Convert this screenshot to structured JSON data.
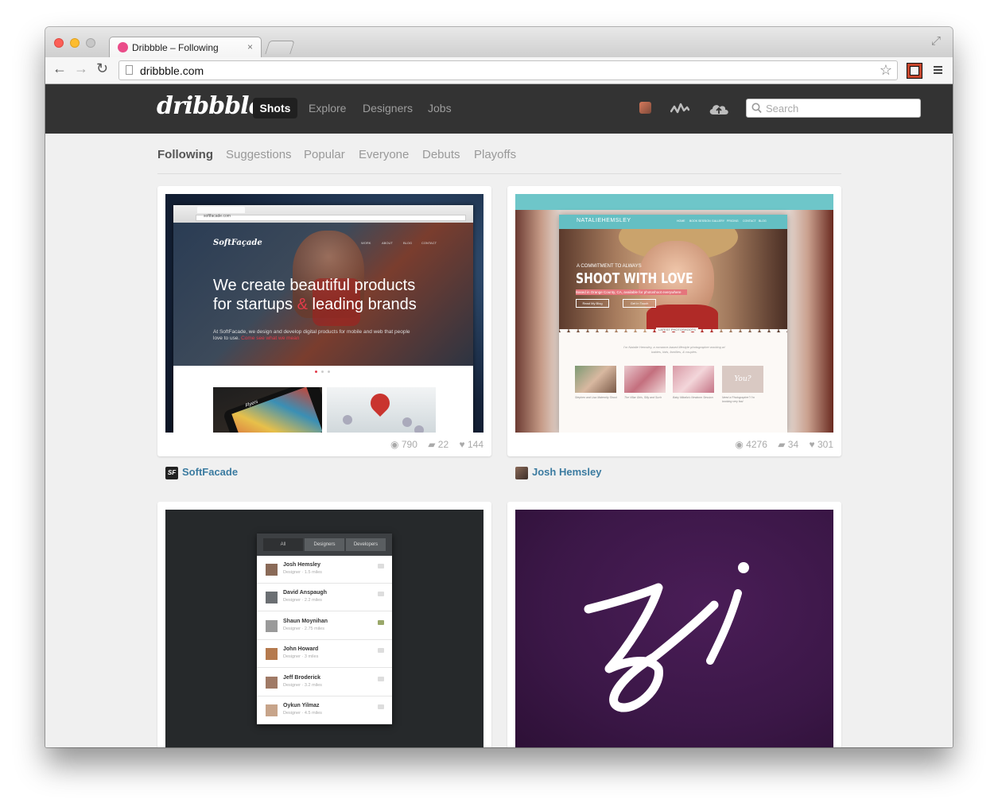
{
  "browser": {
    "tab_title": "Dribbble – Following",
    "tab_close": "×",
    "url": "dribbble.com",
    "nav_glyphs": {
      "back": "←",
      "forward": "→",
      "reload": "↻",
      "star": "☆",
      "fullscreen": "⤢"
    }
  },
  "header": {
    "logo": "dribbble",
    "nav": [
      "Shots",
      "Explore",
      "Designers",
      "Jobs"
    ],
    "active_nav": "Shots",
    "search": {
      "placeholder": "Search"
    }
  },
  "subnav": {
    "items": [
      "Following",
      "Suggestions",
      "Popular",
      "Everyone",
      "Debuts",
      "Playoffs"
    ],
    "active": "Following"
  },
  "shots": [
    {
      "views": "790",
      "comments": "22",
      "likes": "144",
      "owner": "SoftFacade",
      "owner_avatar_text": "SF",
      "preview": {
        "brand": "SoftFaçade",
        "nav": [
          "WORK",
          "ABOUT",
          "BLOG",
          "CONTACT"
        ],
        "headline_1": "We create beautiful products",
        "headline_2a": "for startups ",
        "headline_amp": "&",
        "headline_2b": " leading brands",
        "body": "At SoftFacade, we design and develop digital products for mobile and web that people love to use.",
        "link": "Come see what we mean",
        "url": "softfacade.com",
        "app_label": "Flyers"
      }
    },
    {
      "views": "4276",
      "comments": "34",
      "likes": "301",
      "owner": "Josh Hemsley",
      "preview": {
        "brand": "NATALIEHEMSLEY",
        "nav": [
          "HOME",
          "BOOK SESSION",
          "GALLERY",
          "PRICING",
          "CONTACT",
          "BLOG"
        ],
        "kicker": "A COMMITMENT TO ALWAYS",
        "headline": "SHOOT WITH LOVE",
        "subline": "Based in Orange County, CA, available for photoshoot everywhere",
        "btn1": "Read My Blog",
        "btn2": "Get In Touch",
        "latest": "LATEST PHOTOSHOOTS",
        "intro": "I'm Natalie Hemsley, a romance-based lifestyle photographer working w/ babies, kids, families, & couples.",
        "thumbs": [
          "Stephen and Lisa Maternity Shoot",
          "The Villar Girls, Silly and Such",
          "Baby Mikaila's Newborn Session",
          "Need a Photographer? I'm booking very fast"
        ],
        "thumb_you": "You?"
      }
    },
    {
      "preview": {
        "tabs": [
          "All",
          "Designers",
          "Developers"
        ],
        "people": [
          {
            "name": "Josh Hemsley",
            "meta": "Designer · 1.5 miles"
          },
          {
            "name": "David Anspaugh",
            "meta": "Designer · 2.2 miles"
          },
          {
            "name": "Shaun Moynihan",
            "meta": "Designer · 2.75 miles"
          },
          {
            "name": "John Howard",
            "meta": "Designer · 3 miles"
          },
          {
            "name": "Jeff Broderick",
            "meta": "Designer · 3.2 miles"
          },
          {
            "name": "Oykun Yilmaz",
            "meta": "Designer · 4.5 miles"
          }
        ]
      }
    },
    {
      "preview": {
        "lettering": "zi",
        "background": "#3b1747"
      }
    }
  ],
  "colors": {
    "header_bg": "#333333",
    "link": "#3b7ba0",
    "accent_pink": "#ea4c89",
    "page_bg": "#f0f0f0"
  }
}
